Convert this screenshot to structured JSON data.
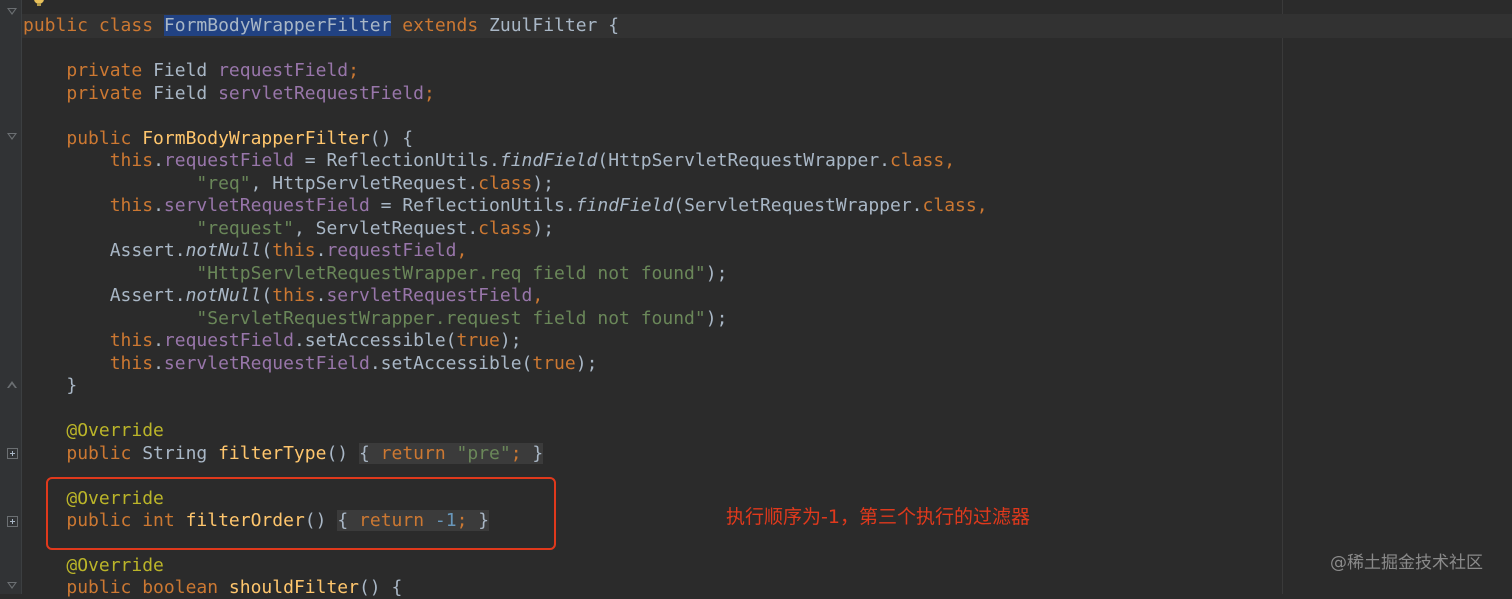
{
  "colors": {
    "background": "#2b2b2b",
    "gutter": "#313335",
    "keyword": "#cc7832",
    "field": "#9876aa",
    "string": "#6a8759",
    "annotation": "#bbb529",
    "number": "#6897bb",
    "method": "#ffc66d",
    "plain": "#a9b7c6",
    "highlight_box": "#e0391c"
  },
  "code": {
    "l1": {
      "kw1": "public class ",
      "class_name": "FormBodyWrapperFilter",
      "kw2": " extends ",
      "rest": "ZuulFilter {"
    },
    "l3": {
      "kw": "private ",
      "type": "Field ",
      "field": "requestField",
      "semi": ";"
    },
    "l4": {
      "kw": "private ",
      "type": "Field ",
      "field": "servletRequestField",
      "semi": ";"
    },
    "l6": {
      "kw": "public ",
      "method": "FormBodyWrapperFilter",
      "rest": "() {"
    },
    "l7": {
      "this": "this",
      "dot": ".",
      "field": "requestField",
      "eq": " = ReflectionUtils.",
      "method": "findField",
      "args": "(HttpServletRequestWrapper.",
      "cls": "class",
      "comma": ","
    },
    "l8": {
      "str": "\"req\"",
      "mid": ", HttpServletRequest.",
      "cls": "class",
      "end": ");"
    },
    "l9": {
      "this": "this",
      "dot": ".",
      "field": "servletRequestField",
      "eq": " = ReflectionUtils.",
      "method": "findField",
      "args": "(ServletRequestWrapper.",
      "cls": "class",
      "comma": ","
    },
    "l10": {
      "str": "\"request\"",
      "mid": ", ServletRequest.",
      "cls": "class",
      "end": ");"
    },
    "l11": {
      "pre": "Assert.",
      "method": "notNull",
      "open": "(",
      "this": "this",
      "dot": ".",
      "field": "requestField",
      "comma": ","
    },
    "l12": {
      "str": "\"HttpServletRequestWrapper.req field not found\"",
      "end": ");"
    },
    "l13": {
      "pre": "Assert.",
      "method": "notNull",
      "open": "(",
      "this": "this",
      "dot": ".",
      "field": "servletRequestField",
      "comma": ","
    },
    "l14": {
      "str": "\"ServletRequestWrapper.request field not found\"",
      "end": ");"
    },
    "l15": {
      "this": "this",
      "dot": ".",
      "field": "requestField",
      "call": ".setAccessible(",
      "val": "true",
      "end": ");"
    },
    "l16": {
      "this": "this",
      "dot": ".",
      "field": "servletRequestField",
      "call": ".setAccessible(",
      "val": "true",
      "end": ");"
    },
    "l17": {
      "text": "}"
    },
    "l19": {
      "text": "@Override"
    },
    "l20": {
      "kw": "public ",
      "type": "String ",
      "method": "filterType",
      "paren": "()",
      "sp": " ",
      "open": "{ ",
      "ret": "return ",
      "str": "\"pre\"",
      "semi": "; ",
      "close": "}"
    },
    "l22": {
      "text": "@Override"
    },
    "l23": {
      "kw": "public int ",
      "method": "filterOrder",
      "paren": "()",
      "sp": " ",
      "open": "{ ",
      "ret": "return ",
      "num": "-1",
      "semi": "; ",
      "close": "}"
    },
    "l25": {
      "text": "@Override"
    },
    "l26": {
      "kw": "public boolean ",
      "method": "shouldFilter",
      "rest": "() {"
    }
  },
  "annotation_text": "执行顺序为-1，第三个执行的过滤器",
  "watermark": "@稀土掘金技术社区"
}
